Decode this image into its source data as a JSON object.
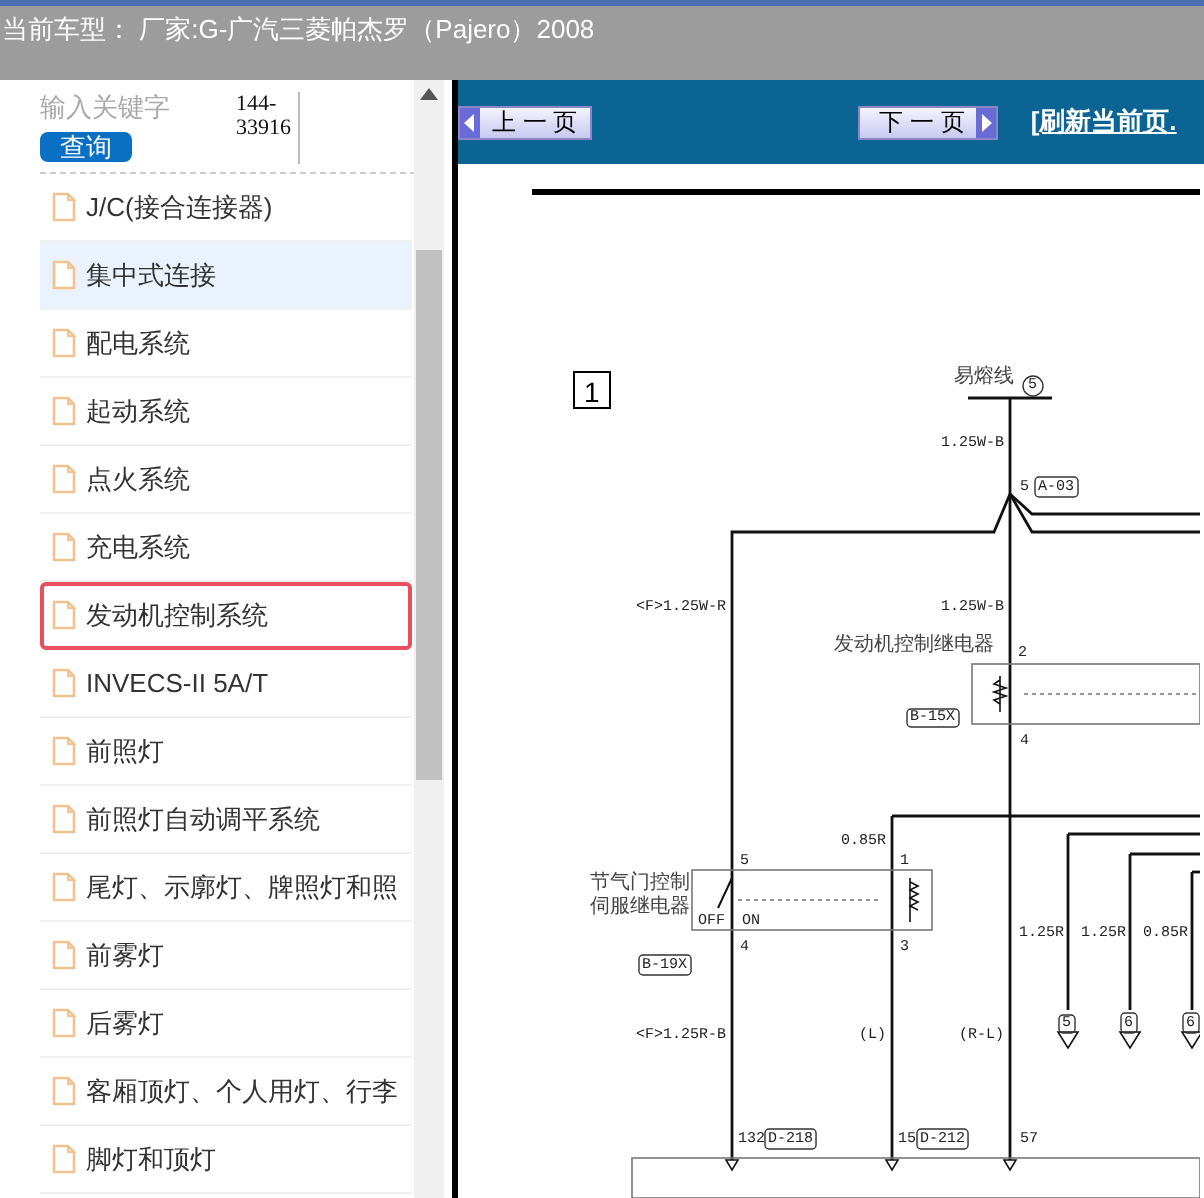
{
  "header": {
    "text": "当前车型： 厂家:G-广汽三菱帕杰罗（Pajero）2008"
  },
  "search": {
    "placeholder": "输入关键字",
    "button": "查询",
    "code": "144-33916"
  },
  "sidebar": {
    "items": [
      {
        "label": "J/C(接合连接器)",
        "highlighted": false,
        "selected": false
      },
      {
        "label": "集中式连接",
        "highlighted": true,
        "selected": false
      },
      {
        "label": "配电系统",
        "highlighted": false,
        "selected": false
      },
      {
        "label": "起动系统",
        "highlighted": false,
        "selected": false
      },
      {
        "label": "点火系统",
        "highlighted": false,
        "selected": false
      },
      {
        "label": "充电系统",
        "highlighted": false,
        "selected": false
      },
      {
        "label": "发动机控制系统",
        "highlighted": false,
        "selected": true
      },
      {
        "label": "INVECS-II 5A/T",
        "highlighted": false,
        "selected": false
      },
      {
        "label": "前照灯",
        "highlighted": false,
        "selected": false
      },
      {
        "label": "前照灯自动调平系统",
        "highlighted": false,
        "selected": false
      },
      {
        "label": "尾灯、示廓灯、牌照灯和照",
        "highlighted": false,
        "selected": false
      },
      {
        "label": "前雾灯",
        "highlighted": false,
        "selected": false
      },
      {
        "label": "后雾灯",
        "highlighted": false,
        "selected": false
      },
      {
        "label": "客厢顶灯、个人用灯、行李",
        "highlighted": false,
        "selected": false
      },
      {
        "label": "脚灯和顶灯",
        "highlighted": false,
        "selected": false
      }
    ]
  },
  "toolbar": {
    "prev": "上 一 页",
    "next": "下 一 页",
    "refresh": "[刷新当前页."
  },
  "diagram": {
    "page_number": "1",
    "labels": [
      {
        "text": "易熔线",
        "kind": "text"
      },
      {
        "text": "5",
        "kind": "circled"
      },
      {
        "text": "1.25W-B",
        "kind": "text"
      },
      {
        "text": "5",
        "kind": "text"
      },
      {
        "text": "A-03",
        "kind": "boxed"
      },
      {
        "text": "<F>1.25W-R",
        "kind": "text"
      },
      {
        "text": "1.25W-B",
        "kind": "text"
      },
      {
        "text": "发动机控制继电器",
        "kind": "text"
      },
      {
        "text": "2",
        "kind": "text"
      },
      {
        "text": "B-15X",
        "kind": "boxed"
      },
      {
        "text": "4",
        "kind": "text"
      },
      {
        "text": "0.85R",
        "kind": "text"
      },
      {
        "text": "5",
        "kind": "text"
      },
      {
        "text": "1",
        "kind": "text"
      },
      {
        "text": "节气门控制",
        "kind": "text"
      },
      {
        "text": "伺服继电器",
        "kind": "text"
      },
      {
        "text": "OFF",
        "kind": "text"
      },
      {
        "text": "ON",
        "kind": "text"
      },
      {
        "text": "4",
        "kind": "text"
      },
      {
        "text": "3",
        "kind": "text"
      },
      {
        "text": "B-19X",
        "kind": "boxed"
      },
      {
        "text": "1.25R",
        "kind": "text"
      },
      {
        "text": "1.25R",
        "kind": "text"
      },
      {
        "text": "0.85R",
        "kind": "text"
      },
      {
        "text": "5",
        "kind": "boxed"
      },
      {
        "text": "6",
        "kind": "boxed"
      },
      {
        "text": "6",
        "kind": "boxed"
      },
      {
        "text": "<F>1.25R-B",
        "kind": "text"
      },
      {
        "text": "(L)",
        "kind": "text"
      },
      {
        "text": "(R-L)",
        "kind": "text"
      },
      {
        "text": "132",
        "kind": "text"
      },
      {
        "text": "D-218",
        "kind": "boxed"
      },
      {
        "text": "15",
        "kind": "text"
      },
      {
        "text": "D-212",
        "kind": "boxed"
      },
      {
        "text": "57",
        "kind": "text"
      }
    ]
  }
}
